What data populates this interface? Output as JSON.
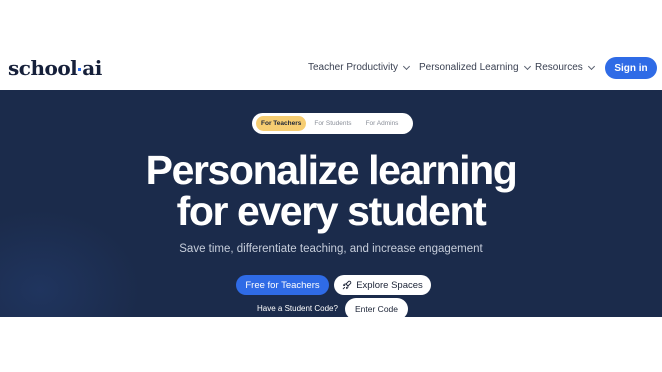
{
  "header": {
    "logo_text": "school",
    "logo_suffix": "ai",
    "nav": [
      {
        "label": "Teacher Productivity"
      },
      {
        "label": "Personalized Learning"
      },
      {
        "label": "Resources"
      }
    ],
    "signin_label": "Sign in"
  },
  "hero": {
    "tabs": [
      {
        "label": "For Teachers",
        "active": true
      },
      {
        "label": "For Students",
        "active": false
      },
      {
        "label": "For Admins",
        "active": false
      }
    ],
    "headline_line1": "Personalize learning",
    "headline_line2": "for every student",
    "subtitle": "Save time, differentiate teaching, and increase engagement",
    "cta_primary": "Free for Teachers",
    "cta_secondary": "Explore Spaces",
    "cta_secondary_icon": "rocket-icon",
    "student_code_prompt": "Have a Student Code?",
    "enter_code_label": "Enter Code"
  },
  "colors": {
    "brand_blue": "#2f6be6",
    "hero_bg": "#1b2b4b",
    "active_tab": "#f6cd72",
    "logo_dot": "#2f6be6"
  }
}
